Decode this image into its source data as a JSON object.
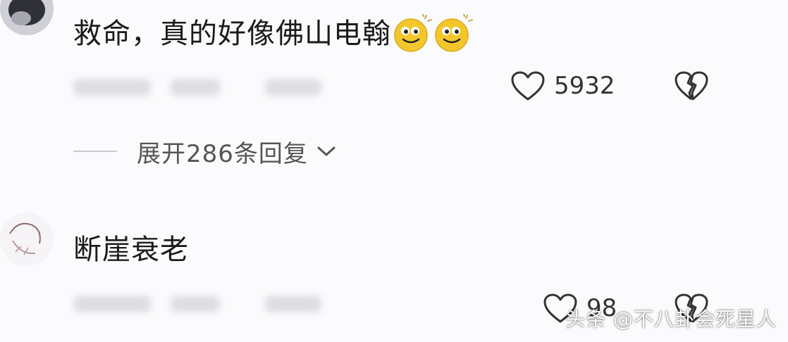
{
  "comments": [
    {
      "text": "救命，真的好像佛山电翰",
      "emojis": [
        "smile-emoji",
        "smile-emoji"
      ],
      "likes": "5932",
      "expand_label": "展开286条回复"
    },
    {
      "text": "断崖衰老",
      "likes": "98"
    }
  ],
  "watermark": "头条 @不八卦会死星人",
  "colors": {
    "background": "#fbfbfd",
    "text": "#1b1b1b",
    "secondary": "#555555",
    "emoji": "#f3c72b"
  }
}
